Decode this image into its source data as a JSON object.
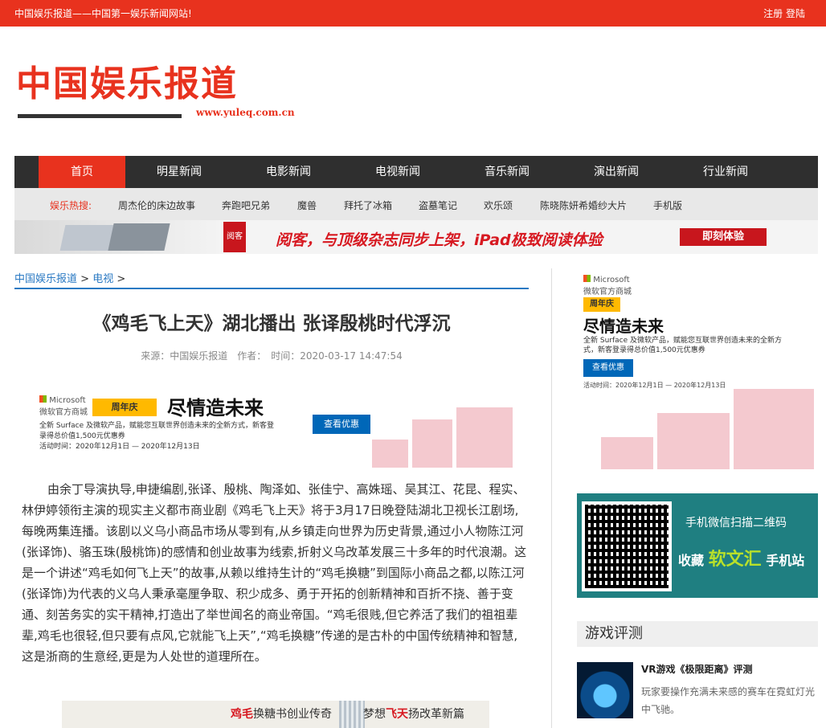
{
  "topbar": {
    "slogan": "中国娱乐报道——中国第一娱乐新闻网站!",
    "register": "注册",
    "login": "登陆"
  },
  "logo": {
    "name": "中国娱乐报道",
    "url": "www.yuleq.com.cn"
  },
  "nav": [
    "首页",
    "明星新闻",
    "电影新闻",
    "电视新闻",
    "音乐新闻",
    "演出新闻",
    "行业新闻"
  ],
  "hot": {
    "label": "娱乐热搜:",
    "items": [
      "周杰伦的床边故事",
      "奔跑吧兄弟",
      "魔兽",
      "拜托了冰箱",
      "盗墓笔记",
      "欢乐颂",
      "陈晓陈妍希婚纱大片",
      "手机版"
    ]
  },
  "banner": {
    "badge": "阅客",
    "slogan": "阅客，与顶级杂志同步上架，iPad极致阅读体验",
    "cta": "即刻体验"
  },
  "breadcrumb": {
    "home": "中国娱乐报道",
    "section": "电视",
    "sep": ">"
  },
  "article": {
    "title": "《鸡毛飞上天》湖北播出 张译殷桃时代浮沉",
    "meta": "来源：中国娱乐报道　作者：　时间：2020-03-17 14:47:54",
    "body": "由余丁导演执导,申捷编剧,张译、殷桃、陶泽如、张佳宁、高姝瑶、吴其江、花昆、程实、林伊婷领衔主演的现实主义都市商业剧《鸡毛飞上天》将于3月17日晚登陆湖北卫视长江剧场,每晚两集连播。该剧以义乌小商品市场从零到有,从乡镇走向世界为历史背景,通过小人物陈江河(张译饰)、骆玉珠(殷桃饰)的感情和创业故事为线索,折射义乌改革发展三十多年的时代浪潮。这是一个讲述“鸡毛如何飞上天”的故事,从赖以维持生计的“鸡毛换糖”到国际小商品之都,以陈江河(张译饰)为代表的义乌人秉承毫厘争取、积少成多、勇于开拓的创新精神和百折不挠、善于变通、刻苦务实的实干精神,打造出了举世闻名的商业帝国。“鸡毛很贱,但它养活了我们的祖祖辈辈,鸡毛也很轻,但只要有点风,它就能飞上天”,“鸡毛换糖”传递的是古朴的中国传统精神和智慧,这是浙商的生意经,更是为人处世的道理所在。"
  },
  "ad": {
    "brand": "Microsoft",
    "brand_sub": "微软官方商城",
    "tag": "周年庆",
    "headline": "尽情造未来",
    "desc": "全新 Surface 及微软产品，赋能您互联世界创造未来的全新方式，新客登录得总价值1,500元优惠券",
    "cta": "查看优惠",
    "date": "活动时间：2020年12月1日 — 2020年12月13日"
  },
  "ad2": {
    "t1a": "鸡毛",
    "t1b": "换糖书创业传奇",
    "t2a": "梦想",
    "t2b": "飞天",
    "t2c": "扬改革新篇"
  },
  "qr": {
    "line1": "手机微信扫描二维码",
    "collect": "收藏",
    "brand": "软文汇",
    "suffix": "手机站"
  },
  "sidebar": {
    "section_title": "游戏评测",
    "game": {
      "title": "VR游戏《极限距离》评测",
      "desc": "玩家要操作充满未来感的赛车在霓虹灯光中飞驰。"
    }
  }
}
